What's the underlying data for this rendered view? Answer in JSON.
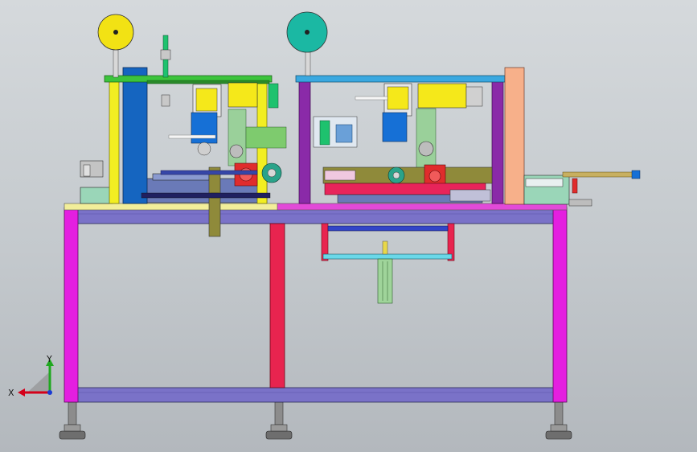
{
  "viewport": {
    "background_top": "#d5d9dc",
    "background_bottom": "#b3b8bd"
  },
  "triad": {
    "x_label": "X",
    "y_label": "Y",
    "x_color": "#d4001a",
    "y_color": "#1fa81f",
    "z_color": "#1a3ad4"
  },
  "colors": {
    "frame_leg": "#e41fe0",
    "frame_rail": "#7a72c8",
    "center_leg": "#e8244f",
    "reel_left": "#f2e214",
    "reel_right": "#1bb8a3",
    "post_yellow": "#f2ee22",
    "plate_blue": "#1565c0",
    "column_purple": "#8a2aa8",
    "pad_salmon": "#f7b08a",
    "cylinder_green": "#1ec26e",
    "motor_yellow": "#f5e81a",
    "motor_blue": "#1670d6",
    "gear_red": "#e02c2c",
    "bar_olive": "#8f8a3a",
    "table_top": "#f2ee9a",
    "feet": "#6e6e6e"
  }
}
